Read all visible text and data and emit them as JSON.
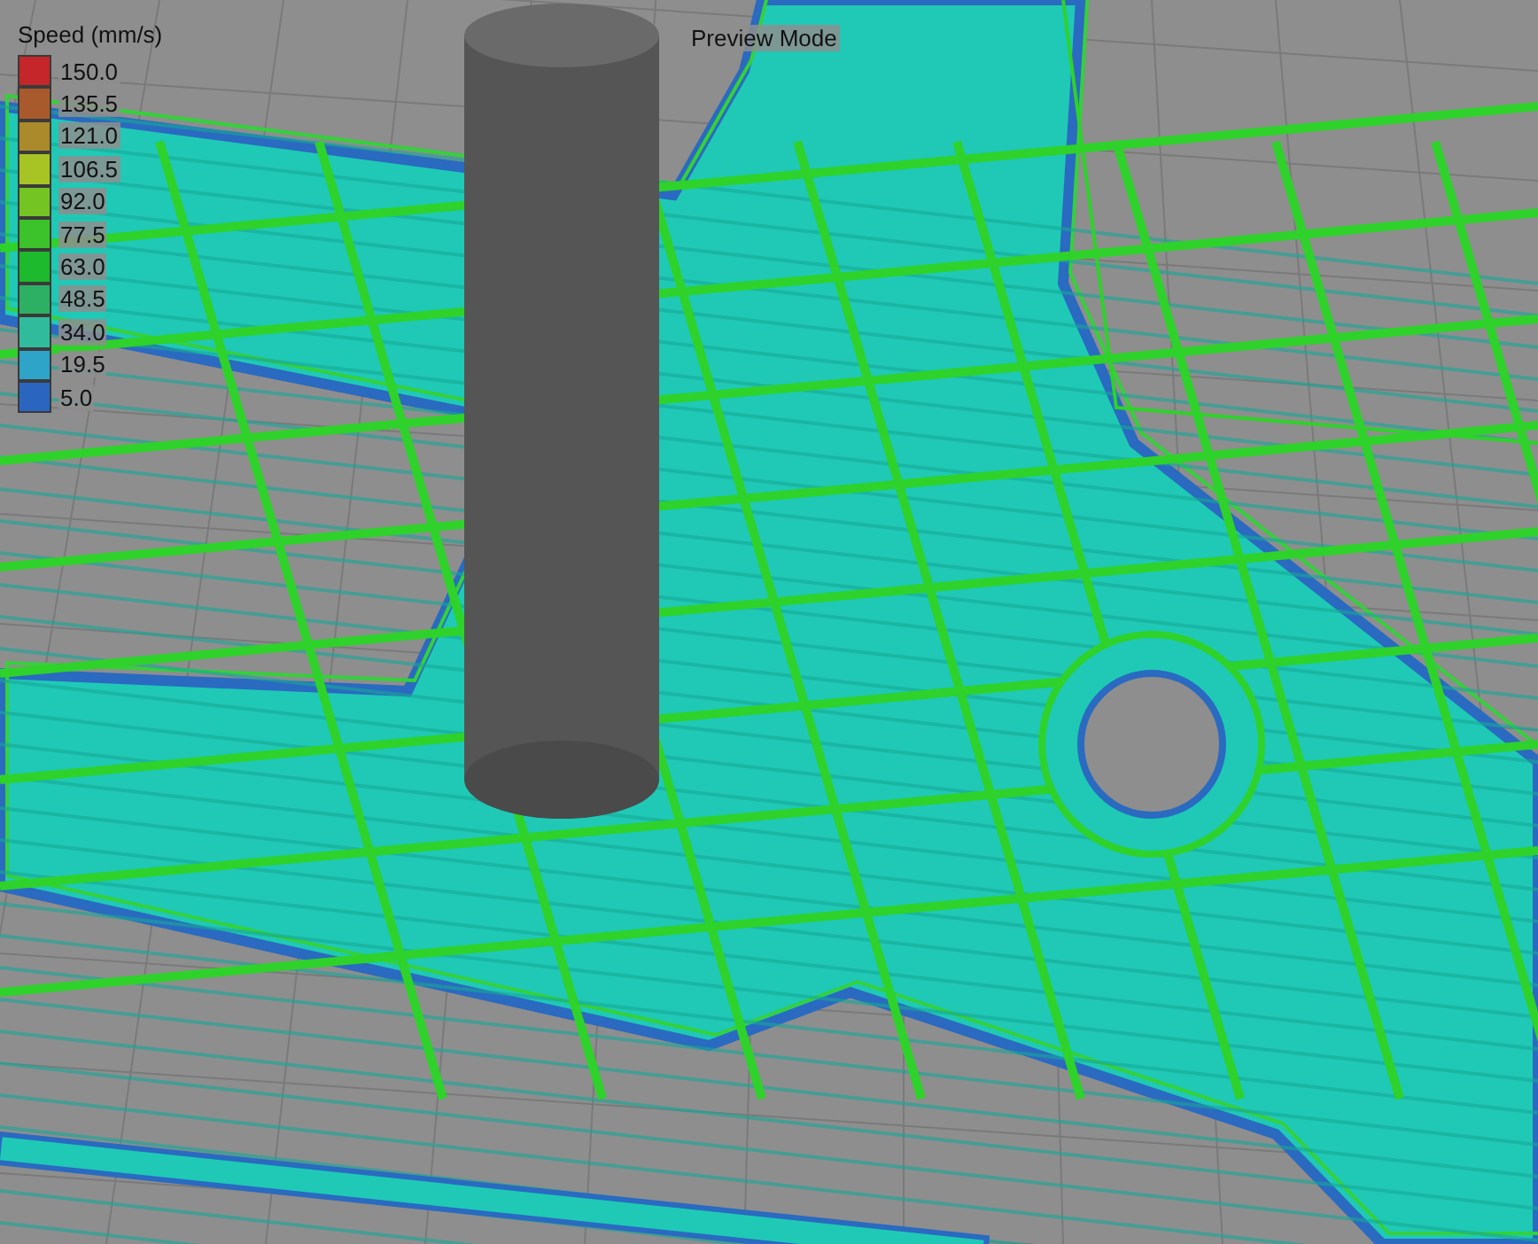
{
  "viewport": {
    "title": "Preview Mode"
  },
  "legend": {
    "title": "Speed (mm/s)",
    "items": [
      {
        "label": "150.0",
        "color": "#c4262a"
      },
      {
        "label": "135.5",
        "color": "#a85a2c"
      },
      {
        "label": "121.0",
        "color": "#aa8a2a"
      },
      {
        "label": "106.5",
        "color": "#a8c424"
      },
      {
        "label": "92.0",
        "color": "#74c424"
      },
      {
        "label": "77.5",
        "color": "#3cc22a"
      },
      {
        "label": "63.0",
        "color": "#1cba2c"
      },
      {
        "label": "48.5",
        "color": "#2eb064"
      },
      {
        "label": "34.0",
        "color": "#30bc9c"
      },
      {
        "label": "19.5",
        "color": "#2ea4c8"
      },
      {
        "label": "5.0",
        "color": "#2a66c0"
      }
    ]
  }
}
